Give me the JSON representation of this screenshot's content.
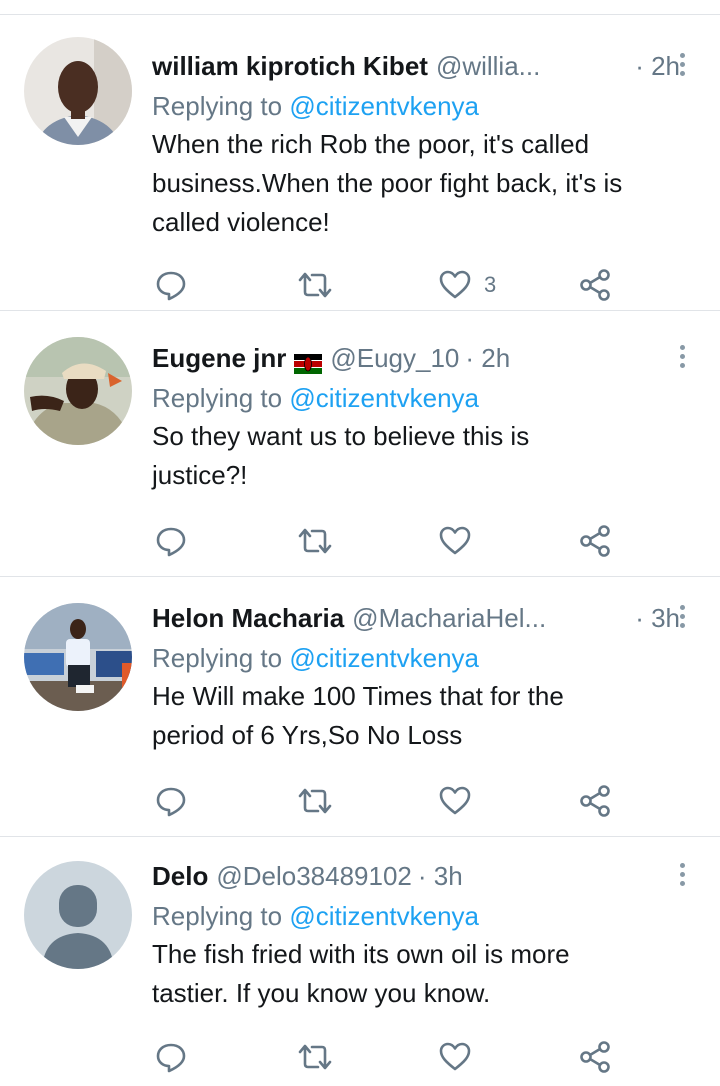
{
  "colors": {
    "accent": "#1da1f2",
    "secondary": "#657786",
    "text": "#14171a",
    "divider": "#e1e4e8"
  },
  "icons": [
    "reply-icon",
    "retweet-icon",
    "like-icon",
    "share-icon",
    "more-icon"
  ],
  "tweets": [
    {
      "name": "william kiprotich Kibet",
      "handle": "@willia...",
      "time": "· 2h",
      "replying_prefix": "Replying to",
      "replying_to": "@citizentvkenya",
      "text_lines": [
        "When the rich Rob the poor, it's called",
        "business.When the poor fight back, it's is",
        "called violence!"
      ],
      "like_count": "3"
    },
    {
      "name": "Eugene jnr",
      "handle": "@Eugy_10",
      "time": "· 2h",
      "replying_prefix": "Replying to",
      "replying_to": "@citizentvkenya",
      "text_lines": [
        "So they want us to believe this is",
        "justice?!"
      ],
      "like_count": ""
    },
    {
      "name": "Helon Macharia",
      "handle": "@MachariaHel...",
      "time": "· 3h",
      "replying_prefix": "Replying to",
      "replying_to": "@citizentvkenya",
      "text_lines": [
        "He Will make 100 Times that for the",
        "period of 6 Yrs,So No Loss"
      ],
      "like_count": ""
    },
    {
      "name": "Delo",
      "handle": "@Delo38489102",
      "time": "· 3h",
      "replying_prefix": "Replying to",
      "replying_to": "@citizentvkenya",
      "text_lines": [
        "The fish fried with its own oil is more",
        "tastier. If you know you know."
      ],
      "like_count": ""
    }
  ]
}
